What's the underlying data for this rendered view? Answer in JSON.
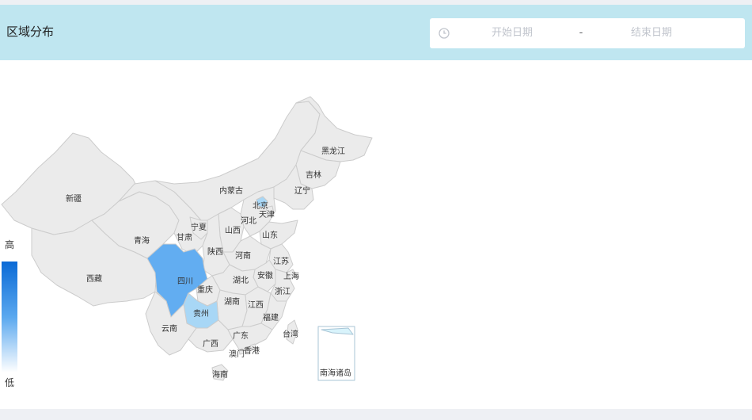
{
  "header": {
    "title": "区域分布",
    "date_range": {
      "start_placeholder": "开始日期",
      "separator": "-",
      "end_placeholder": "结束日期",
      "icon": "clock-icon"
    }
  },
  "colors": {
    "header_bg": "#bfe6f0",
    "base_region": "#ebebeb",
    "border": "#cccccc",
    "highlight_high": "#62adf1",
    "highlight_low": "#a8d7f6",
    "legend_high": "#0a6ad6",
    "legend_low": "#ffffff"
  },
  "legend": {
    "high": "高",
    "low": "低"
  },
  "regions": {
    "xinjiang": "新疆",
    "xizang": "西藏",
    "qinghai": "青海",
    "gansu": "甘肃",
    "neimenggu": "内蒙古",
    "heilongjiang": "黑龙江",
    "jilin": "吉林",
    "liaoning": "辽宁",
    "beijing": "北京",
    "tianjin": "天津",
    "hebei": "河北",
    "ningxia": "宁夏",
    "shanxi": "山西",
    "shandong": "山东",
    "shaanxi": "陕西",
    "henan": "河南",
    "jiangsu": "江苏",
    "sichuan": "四川",
    "chongqing": "重庆",
    "hubei": "湖北",
    "anhui": "安徽",
    "shanghai": "上海",
    "zhejiang": "浙江",
    "hunan": "湖南",
    "jiangxi": "江西",
    "guizhou": "贵州",
    "fujian": "福建",
    "yunnan": "云南",
    "guangxi": "广西",
    "guangdong": "广东",
    "taiwan": "台湾",
    "xianggang": "香港",
    "aomen": "澳门",
    "hainan": "海南",
    "nanhai": "南海诸岛"
  },
  "highlighted": {
    "sichuan": "high",
    "guizhou": "low",
    "beijing": "low"
  }
}
